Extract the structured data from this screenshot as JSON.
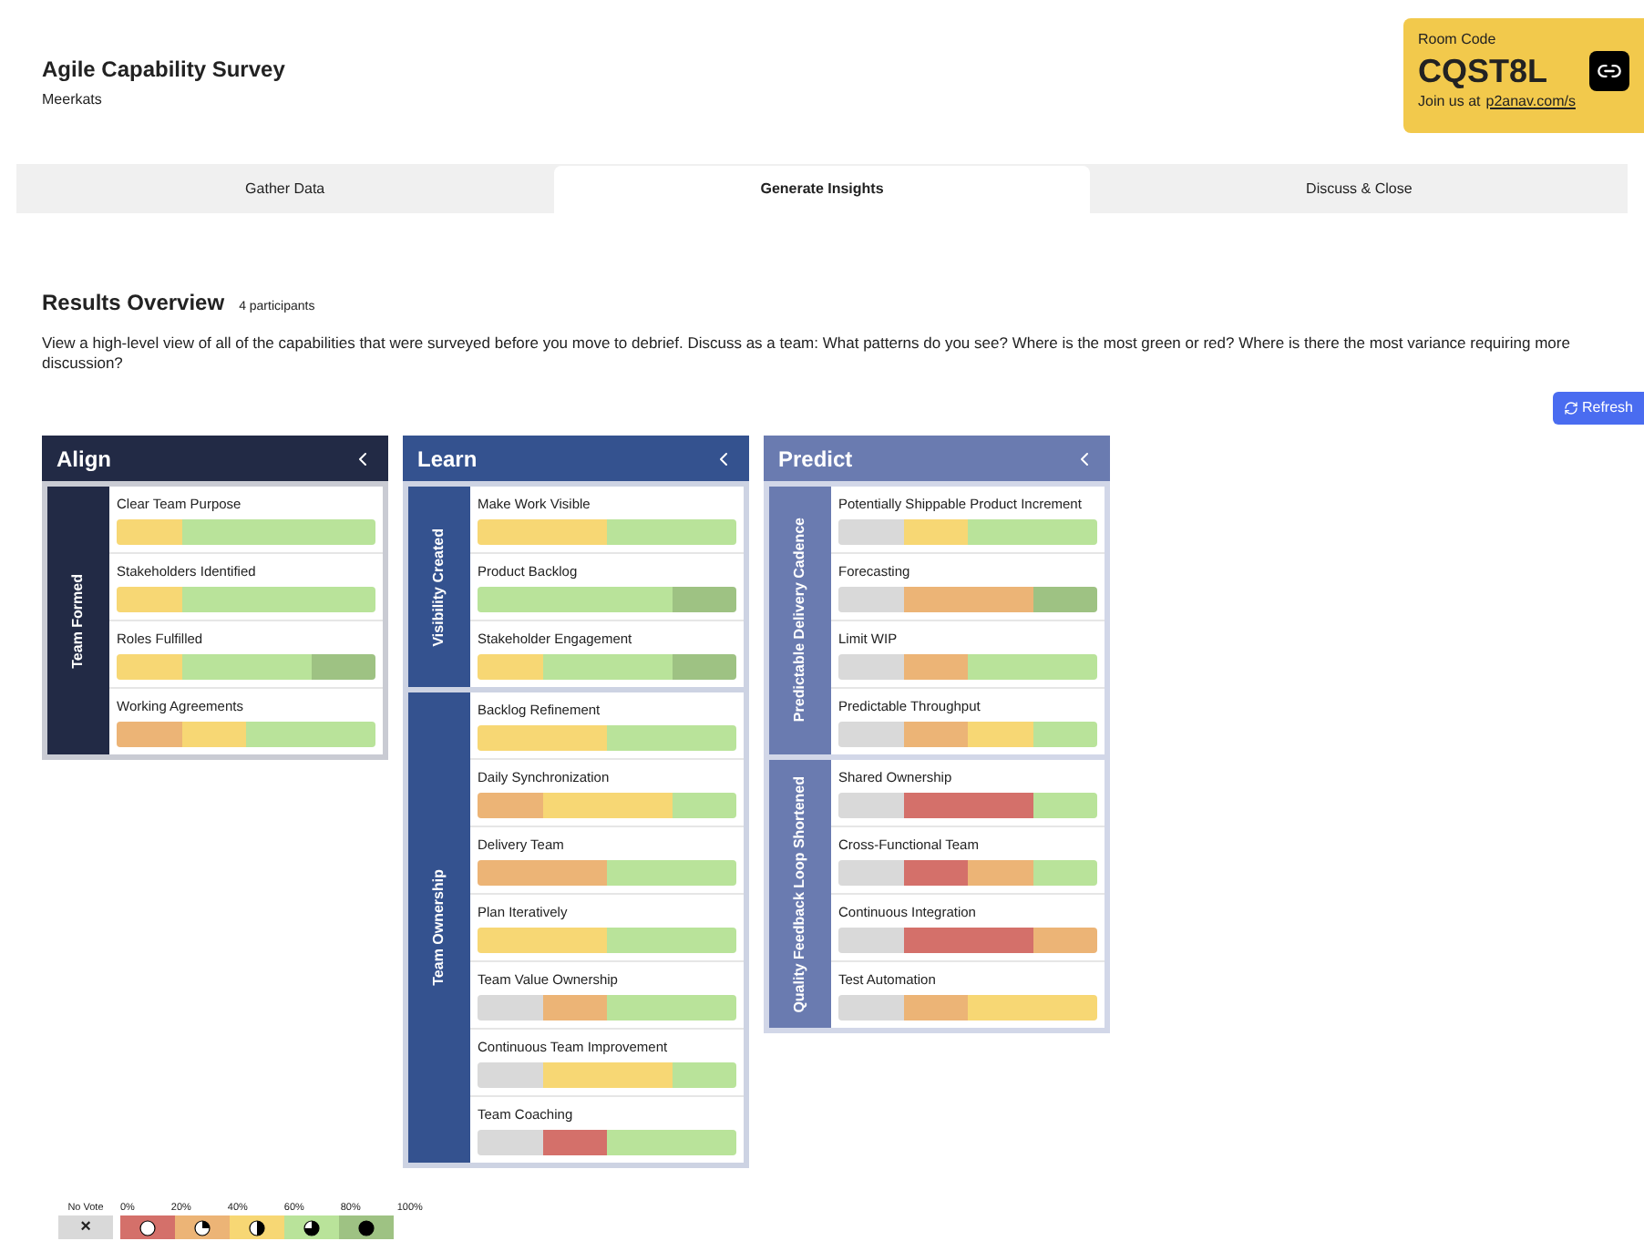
{
  "header": {
    "title": "Agile Capability Survey",
    "team": "Meerkats"
  },
  "room": {
    "label": "Room Code",
    "code": "CQST8L",
    "join_text": "Join us at",
    "join_link": "p2anav.com/s"
  },
  "tabs": [
    {
      "label": "Gather Data",
      "selected": false
    },
    {
      "label": "Generate Insights",
      "selected": true
    },
    {
      "label": "Discuss & Close",
      "selected": false
    }
  ],
  "results": {
    "title": "Results Overview",
    "participants": "4 participants",
    "description": "View a high-level view of all of the capabilities that were surveyed before you move to debrief. Discuss as a team: What patterns do you see? Where is the most green or red? Where is there the most variance requiring more discussion?",
    "refresh": "Refresh"
  },
  "columns": [
    {
      "title": "Align",
      "color": "#222a45",
      "groups": [
        {
          "title": "Team Formed",
          "items": [
            {
              "name": "Clear Team Purpose",
              "votes": [
                {
                  "color": "#f7d774"
                },
                {
                  "color": "#b9e39a"
                },
                {
                  "color": "#b9e39a"
                },
                {
                  "color": "#b9e39a"
                }
              ]
            },
            {
              "name": "Stakeholders Identified",
              "votes": [
                {
                  "color": "#f7d774"
                },
                {
                  "color": "#b9e39a"
                },
                {
                  "color": "#b9e39a"
                },
                {
                  "color": "#b9e39a"
                }
              ]
            },
            {
              "name": "Roles Fulfilled",
              "votes": [
                {
                  "color": "#f7d774"
                },
                {
                  "color": "#b9e39a"
                },
                {
                  "color": "#b9e39a"
                },
                {
                  "color": "#9ec283"
                }
              ]
            },
            {
              "name": "Working Agreements",
              "votes": [
                {
                  "color": "#ecb476"
                },
                {
                  "color": "#f7d774"
                },
                {
                  "color": "#b9e39a"
                },
                {
                  "color": "#b9e39a"
                }
              ]
            }
          ]
        }
      ]
    },
    {
      "title": "Learn",
      "color": "#34528f",
      "groups": [
        {
          "title": "Visibility Created",
          "items": [
            {
              "name": "Make Work Visible",
              "votes": [
                {
                  "color": "#f7d774"
                },
                {
                  "color": "#f7d774"
                },
                {
                  "color": "#b9e39a"
                },
                {
                  "color": "#b9e39a"
                }
              ]
            },
            {
              "name": "Product Backlog",
              "votes": [
                {
                  "color": "#b9e39a"
                },
                {
                  "color": "#b9e39a"
                },
                {
                  "color": "#b9e39a"
                },
                {
                  "color": "#9ec283"
                }
              ]
            },
            {
              "name": "Stakeholder Engagement",
              "votes": [
                {
                  "color": "#f7d774"
                },
                {
                  "color": "#b9e39a"
                },
                {
                  "color": "#b9e39a"
                },
                {
                  "color": "#9ec283"
                }
              ]
            }
          ]
        },
        {
          "title": "Team Ownership",
          "items": [
            {
              "name": "Backlog Refinement",
              "votes": [
                {
                  "color": "#f7d774"
                },
                {
                  "color": "#f7d774"
                },
                {
                  "color": "#b9e39a"
                },
                {
                  "color": "#b9e39a"
                }
              ]
            },
            {
              "name": "Daily Synchronization",
              "votes": [
                {
                  "color": "#ecb476"
                },
                {
                  "color": "#f7d774"
                },
                {
                  "color": "#f7d774"
                },
                {
                  "color": "#b9e39a"
                }
              ]
            },
            {
              "name": "Delivery Team",
              "votes": [
                {
                  "color": "#ecb476"
                },
                {
                  "color": "#ecb476"
                },
                {
                  "color": "#b9e39a"
                },
                {
                  "color": "#b9e39a"
                }
              ]
            },
            {
              "name": "Plan Iteratively",
              "votes": [
                {
                  "color": "#f7d774"
                },
                {
                  "color": "#f7d774"
                },
                {
                  "color": "#b9e39a"
                },
                {
                  "color": "#b9e39a"
                }
              ]
            },
            {
              "name": "Team Value Ownership",
              "votes": [
                {
                  "color": "#d9d9d9"
                },
                {
                  "color": "#ecb476"
                },
                {
                  "color": "#b9e39a"
                },
                {
                  "color": "#b9e39a"
                }
              ]
            },
            {
              "name": "Continuous Team Improvement",
              "votes": [
                {
                  "color": "#d9d9d9"
                },
                {
                  "color": "#f7d774"
                },
                {
                  "color": "#f7d774"
                },
                {
                  "color": "#b9e39a"
                }
              ]
            },
            {
              "name": "Team Coaching",
              "votes": [
                {
                  "color": "#d9d9d9"
                },
                {
                  "color": "#d4706a"
                },
                {
                  "color": "#b9e39a"
                },
                {
                  "color": "#b9e39a"
                }
              ]
            }
          ]
        }
      ]
    },
    {
      "title": "Predict",
      "color": "#6a7bb0",
      "groups": [
        {
          "title": "Predictable Delivery Cadence",
          "items": [
            {
              "name": "Potentially Shippable Product Increment",
              "votes": [
                {
                  "color": "#d9d9d9"
                },
                {
                  "color": "#f7d774"
                },
                {
                  "color": "#b9e39a"
                },
                {
                  "color": "#b9e39a"
                }
              ]
            },
            {
              "name": "Forecasting",
              "votes": [
                {
                  "color": "#d9d9d9"
                },
                {
                  "color": "#ecb476"
                },
                {
                  "color": "#ecb476"
                },
                {
                  "color": "#9ec283"
                }
              ]
            },
            {
              "name": "Limit WIP",
              "votes": [
                {
                  "color": "#d9d9d9"
                },
                {
                  "color": "#ecb476"
                },
                {
                  "color": "#b9e39a"
                },
                {
                  "color": "#b9e39a"
                }
              ]
            },
            {
              "name": "Predictable Throughput",
              "votes": [
                {
                  "color": "#d9d9d9"
                },
                {
                  "color": "#ecb476"
                },
                {
                  "color": "#f7d774"
                },
                {
                  "color": "#b9e39a"
                }
              ]
            }
          ]
        },
        {
          "title": "Quality Feedback Loop Shortened",
          "items": [
            {
              "name": "Shared Ownership",
              "votes": [
                {
                  "color": "#d9d9d9"
                },
                {
                  "color": "#d4706a"
                },
                {
                  "color": "#d4706a"
                },
                {
                  "color": "#b9e39a"
                }
              ]
            },
            {
              "name": "Cross-Functional Team",
              "votes": [
                {
                  "color": "#d9d9d9"
                },
                {
                  "color": "#d4706a"
                },
                {
                  "color": "#ecb476"
                },
                {
                  "color": "#b9e39a"
                }
              ]
            },
            {
              "name": "Continuous Integration",
              "votes": [
                {
                  "color": "#d9d9d9"
                },
                {
                  "color": "#d4706a"
                },
                {
                  "color": "#d4706a"
                },
                {
                  "color": "#ecb476"
                }
              ]
            },
            {
              "name": "Test Automation",
              "votes": [
                {
                  "color": "#d9d9d9"
                },
                {
                  "color": "#ecb476"
                },
                {
                  "color": "#f7d774"
                },
                {
                  "color": "#f7d774"
                }
              ]
            }
          ]
        }
      ]
    }
  ],
  "legend": {
    "no_vote": {
      "label": "No Vote",
      "symbol": "×",
      "color": "#d9d9d9"
    },
    "ticks": [
      "0%",
      "20%",
      "40%",
      "60%",
      "80%",
      "100%"
    ],
    "levels": [
      {
        "color": "#d4706a"
      },
      {
        "color": "#ecb476"
      },
      {
        "color": "#f7d774"
      },
      {
        "color": "#b9e39a"
      },
      {
        "color": "#9ec283"
      }
    ]
  }
}
